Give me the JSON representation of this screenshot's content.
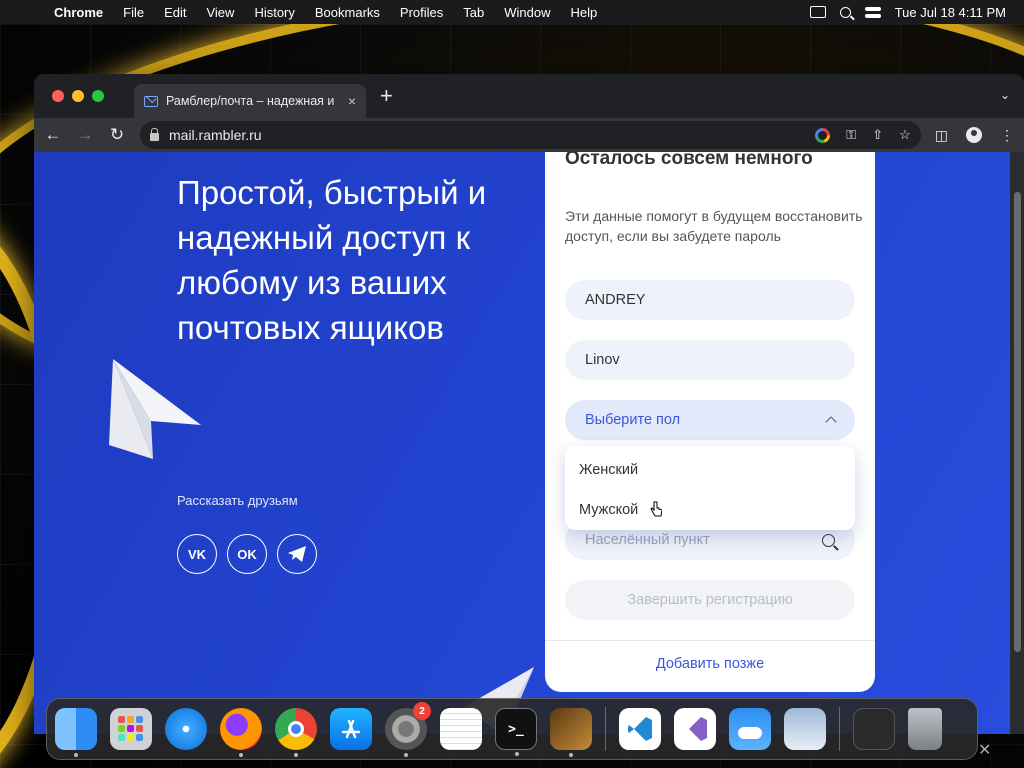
{
  "menubar": {
    "app": "Chrome",
    "items": [
      "File",
      "Edit",
      "View",
      "History",
      "Bookmarks",
      "Profiles",
      "Tab",
      "Window",
      "Help"
    ],
    "datetime": "Tue Jul 18  4:11 PM"
  },
  "browser": {
    "tab_title": "Рамблер/почта – надежная и",
    "tab_close": "×",
    "new_tab": "+",
    "url": "mail.rambler.ru"
  },
  "page": {
    "hero": "Простой, быстрый и надежный доступ к любому из ваших почтовых ящиков",
    "share_label": "Рассказать друзьям",
    "socials": [
      "vk",
      "ok",
      "telegram"
    ],
    "card": {
      "title": "Осталось совсем немного",
      "description": "Эти данные помогут в будущем восстановить доступ, если вы забудете пароль",
      "first_name": "ANDREY",
      "last_name": "Linov",
      "gender_placeholder": "Выберите пол",
      "gender_options": [
        "Женский",
        "Мужской"
      ],
      "city_placeholder": "Населённый пункт",
      "submit": "Завершить регистрацию",
      "later": "Добавить позже"
    }
  },
  "dock": {
    "apps": [
      "finder-icon",
      "launchpad-icon",
      "safari-icon",
      "firefox-icon",
      "chrome-icon",
      "app-store-icon",
      "system-settings-icon",
      "textedit-icon",
      "terminal-icon",
      "garageband-icon",
      "vscode-icon",
      "visual-studio-icon",
      "weather-icon",
      "preview-icon",
      "desktop-folder-icon",
      "trash-icon"
    ],
    "settings_badge": "2",
    "terminal_glyph": ">_",
    "vk_glyph": "VK",
    "ok_glyph": "OK"
  },
  "colors": {
    "page_blue": "#2346d4",
    "link_blue": "#3b57d8",
    "field_bg": "#eef2fb"
  }
}
